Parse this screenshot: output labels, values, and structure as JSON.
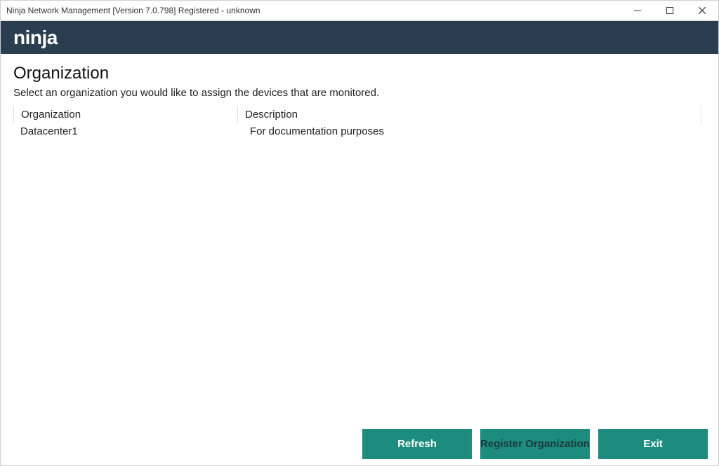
{
  "window": {
    "title": "Ninja Network Management [Version 7.0.798] Registered - unknown"
  },
  "brand": {
    "name": "ninja"
  },
  "page": {
    "heading": "Organization",
    "subtitle": "Select an organization you would like to assign the devices that are monitored."
  },
  "table": {
    "headers": {
      "org": "Organization",
      "desc": "Description"
    },
    "rows": [
      {
        "org": "Datacenter1",
        "desc": "For documentation purposes"
      }
    ]
  },
  "buttons": {
    "refresh": "Refresh",
    "register": "Register Organization",
    "exit": "Exit"
  }
}
